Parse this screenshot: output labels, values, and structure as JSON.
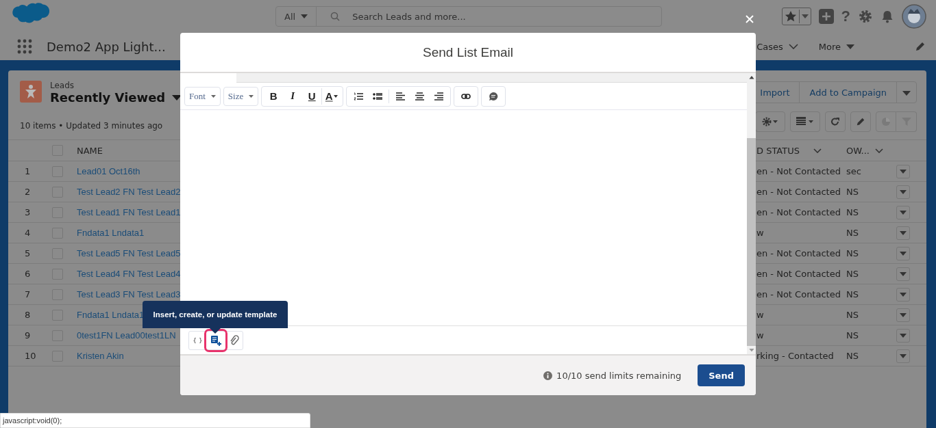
{
  "header": {
    "search_scope": "All",
    "search_placeholder": "Search Leads and more...",
    "help": "?"
  },
  "nav": {
    "app_name": "Demo2 App Light...",
    "items": [
      {
        "label": "Cases",
        "kind": "chevron"
      },
      {
        "label": "More",
        "kind": "caret"
      }
    ]
  },
  "list": {
    "object": "Leads",
    "view": "Recently Viewed",
    "meta": "10 items • Updated 3 minutes ago",
    "actions": [
      "Import",
      "Add to Campaign"
    ],
    "select_all_checked": false,
    "columns": [
      {
        "label": "NAME",
        "sortable": false
      },
      {
        "label": "D STATUS",
        "sortable": true
      },
      {
        "label": "OW...",
        "sortable": true
      }
    ],
    "rows": [
      {
        "number": "1",
        "name": "Lead01 Oct16th",
        "status": "en - Not Contacted",
        "owner": "sec",
        "checked": false
      },
      {
        "number": "2",
        "name": "Test Lead2 FN Test Lead2",
        "status": "en - Not Contacted",
        "owner": "NS",
        "checked": false
      },
      {
        "number": "3",
        "name": "Test Lead1 FN Test Lead1",
        "status": "en - Not Contacted",
        "owner": "NS",
        "checked": false
      },
      {
        "number": "4",
        "name": "Fndata1 Lndata1",
        "status": "w",
        "owner": "NS",
        "checked": false
      },
      {
        "number": "5",
        "name": "Test Lead5 FN Test Lead5",
        "status": "en - Not Contacted",
        "owner": "NS",
        "checked": false
      },
      {
        "number": "6",
        "name": "Test Lead4 FN Test Lead4",
        "status": "en - Not Contacted",
        "owner": "NS",
        "checked": false
      },
      {
        "number": "7",
        "name": "Test Lead3 FN Test Lead3",
        "status": "en - Not Contacted",
        "owner": "NS",
        "checked": false
      },
      {
        "number": "8",
        "name": "Fndata1 Lndata1",
        "status": "w",
        "owner": "NS",
        "checked": false
      },
      {
        "number": "9",
        "name": "0test1FN Lead00test1LN",
        "status": "w",
        "owner": "NS",
        "checked": false
      },
      {
        "number": "10",
        "name": "Kristen Akin",
        "status": "rking - Contacted",
        "owner": "NS",
        "checked": false
      }
    ]
  },
  "modal": {
    "title": "Send List Email",
    "font": "Font",
    "size": "Size",
    "format_buttons": [
      {
        "label": "B",
        "kind": "bold"
      },
      {
        "label": "I",
        "kind": "italic"
      },
      {
        "label": "U",
        "kind": "underline"
      },
      {
        "label": "A",
        "kind": "color"
      }
    ],
    "footer_tools": [
      {
        "kind": "merge",
        "label": "{ }",
        "focused": false
      },
      {
        "kind": "template",
        "focused": true
      },
      {
        "kind": "attach",
        "focused": false
      }
    ],
    "tooltip": "Insert, create, or update template",
    "limits": "10/10 send limits remaining",
    "send": "Send"
  },
  "status_bar": "javascript:void(0);"
}
